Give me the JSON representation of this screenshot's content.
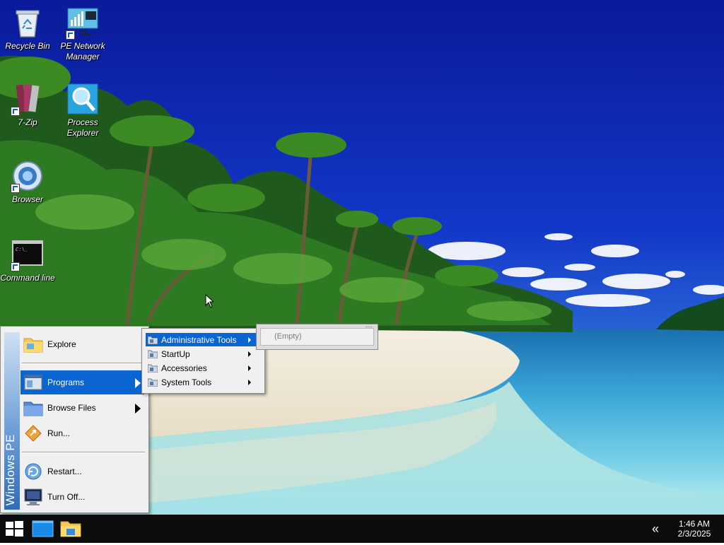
{
  "desktop": {
    "icons": [
      {
        "name": "recycle-bin",
        "label": "Recycle Bin"
      },
      {
        "name": "pe-network-manager",
        "label": "PE Network Manager"
      },
      {
        "name": "7-zip",
        "label": "7-Zip"
      },
      {
        "name": "process-explorer",
        "label": "Process Explorer"
      },
      {
        "name": "browser",
        "label": "Browser"
      },
      {
        "name": "command-line",
        "label": "Command line"
      }
    ]
  },
  "start_menu": {
    "banner": "Windows PE",
    "items": [
      {
        "label": "Explore",
        "icon": "folder-icon",
        "has_submenu": false
      },
      {
        "label": "Programs",
        "icon": "programs-icon",
        "has_submenu": true,
        "selected": true
      },
      {
        "label": "Browse Files",
        "icon": "folder-icon",
        "has_submenu": true
      },
      {
        "label": "Run...",
        "icon": "run-icon",
        "has_submenu": false
      },
      {
        "label": "Restart...",
        "icon": "restart-icon",
        "has_submenu": false
      },
      {
        "label": "Turn Off...",
        "icon": "monitor-icon",
        "has_submenu": false
      }
    ]
  },
  "programs_submenu": {
    "items": [
      {
        "label": "Administrative Tools",
        "selected": true
      },
      {
        "label": "StartUp"
      },
      {
        "label": "Accessories"
      },
      {
        "label": "System Tools"
      }
    ]
  },
  "admin_submenu": {
    "empty_label": "(Empty)"
  },
  "taskbar": {
    "start_icon": "windows-logo-icon",
    "pinned": [
      "desktop-icon",
      "file-explorer-icon"
    ],
    "tray_overflow": "«",
    "clock_time": "1:46 AM",
    "clock_date": "2/3/2025"
  },
  "colors": {
    "selection": "#0a64d2",
    "taskbar": "#0c0c0c",
    "menu_bg": "#f0f0f0"
  }
}
